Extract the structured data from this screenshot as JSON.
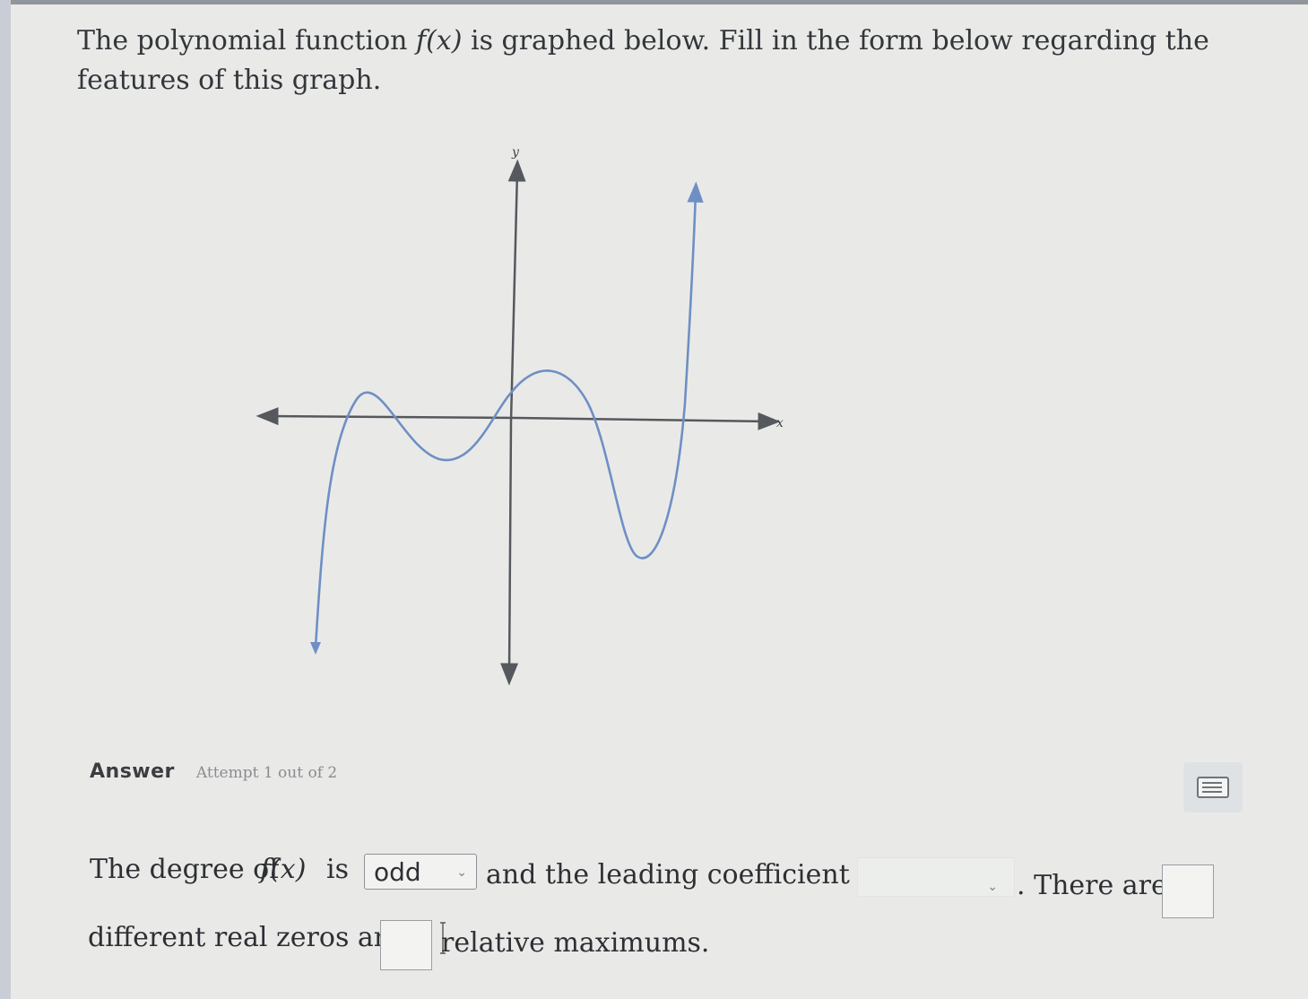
{
  "prompt": {
    "part1": "The polynomial function ",
    "fx": "f(x)",
    "part2": " is graphed below. Fill in the form below regarding the features of this graph."
  },
  "graph": {
    "x_label": "x",
    "y_label": "y",
    "curve_color": "#6f8fc4",
    "axis_color": "#55585c"
  },
  "answer": {
    "label": "Answer",
    "attempt": "Attempt 1 out of 2"
  },
  "sentence": {
    "s1": "The degree of ",
    "fx": "f(x)",
    "s2": " is",
    "degree_value": "odd",
    "s3": "and the leading coefficient is",
    "leading_value": "",
    "s4": ". There are",
    "s5": "different real zeros and",
    "s6": "relative maximums."
  },
  "icons": {
    "dropdown": "chevron-down-icon",
    "keyboard": "keyboard-icon"
  }
}
